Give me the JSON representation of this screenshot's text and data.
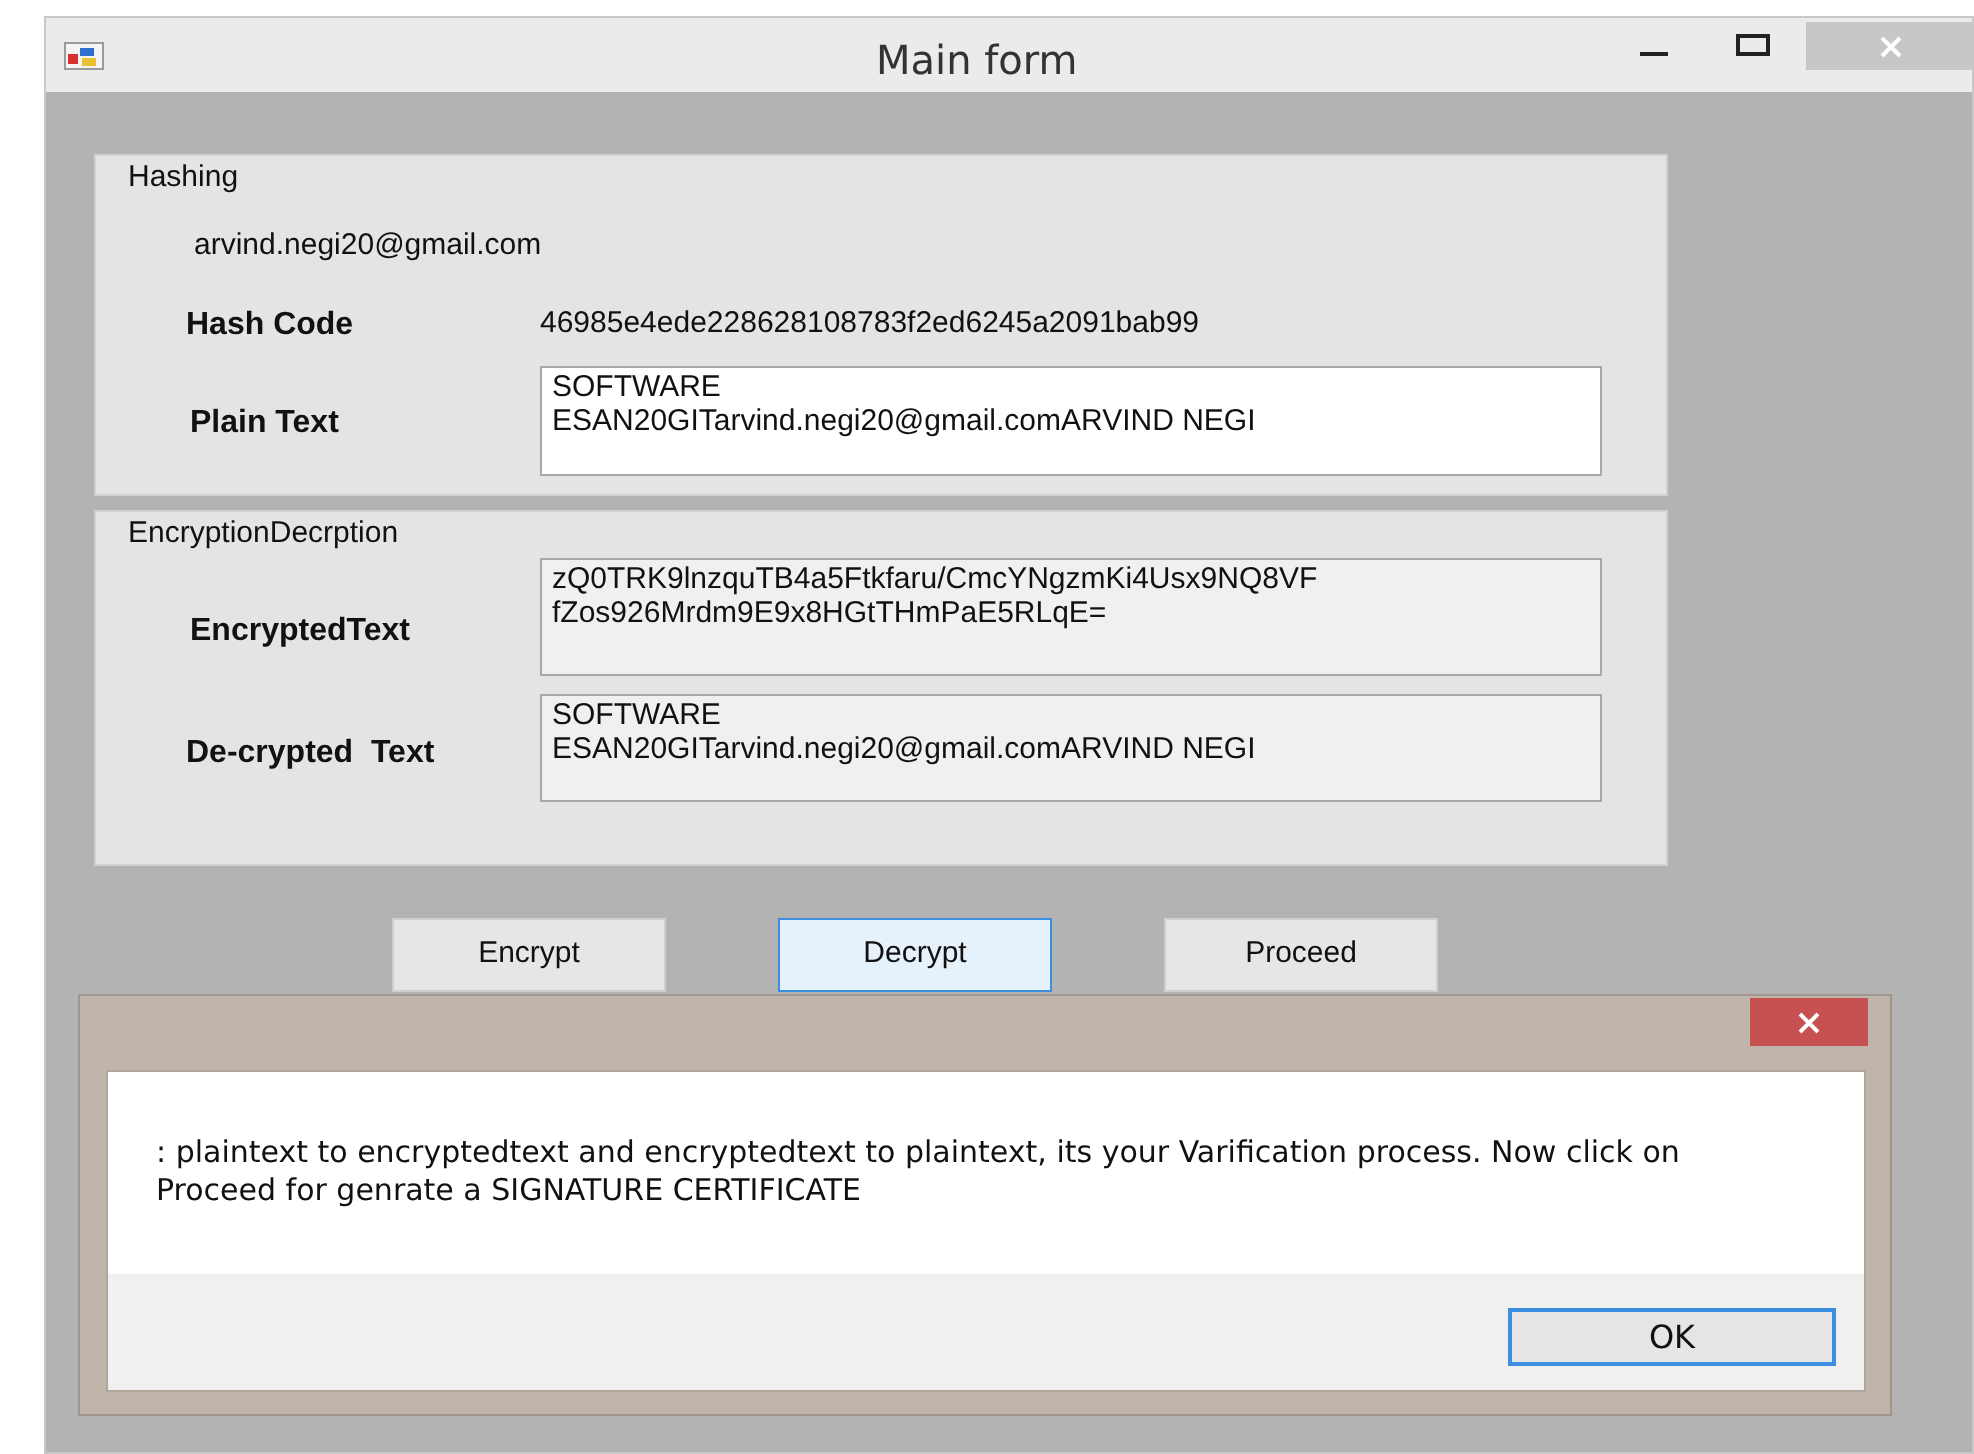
{
  "window": {
    "title": "Main form"
  },
  "hashing": {
    "title": "Hashing",
    "email": "arvind.negi20@gmail.com",
    "hash_label": "Hash Code",
    "hash_value": "46985e4ede228628108783f2ed6245a2091bab99",
    "plain_label": "Plain Text",
    "plain_value": "SOFTWARE\nESAN20GITarvind.negi20@gmail.comARVIND NEGI"
  },
  "encryption": {
    "title": "EncryptionDecrption",
    "encrypted_label": "EncryptedText",
    "encrypted_value": "zQ0TRK9lnzquTB4a5Ftkfaru/CmcYNgzmKi4Usx9NQ8VF\nfZos926Mrdm9E9x8HGtTHmPaE5RLqE=",
    "decrypted_label": "De-crypted  Text",
    "decrypted_value": "SOFTWARE\nESAN20GITarvind.negi20@gmail.comARVIND NEGI"
  },
  "buttons": [
    {
      "label": "Encrypt",
      "focused": false
    },
    {
      "label": "Decrypt",
      "focused": true
    },
    {
      "label": "Proceed",
      "focused": false
    }
  ],
  "message_box": {
    "text": ": plaintext to encryptedtext and encryptedtext to plaintext, its your Varification process. Now click on Proceed for genrate a SIGNATURE CERTIFICATE",
    "ok_button": {
      "label": "OK",
      "focused": true
    }
  }
}
